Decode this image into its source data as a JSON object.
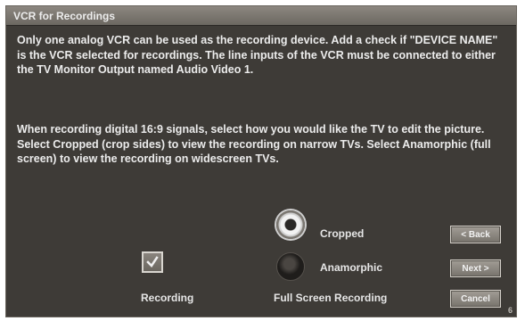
{
  "dialog": {
    "title": "VCR for Recordings",
    "paragraph1": "Only one analog VCR can be used as the recording device.  Add a check if \"DEVICE NAME\" is the VCR selected for recordings.  The line inputs of the VCR must be connected to either the TV Monitor Output named Audio Video 1.",
    "paragraph2": "When recording digital 16:9 signals, select how you would like the TV to edit the picture.  Select Cropped (crop sides) to view the recording on narrow TVs.  Select Anamorphic (full screen) to view the recording on widescreen TVs."
  },
  "options": {
    "cropped_label": "Cropped",
    "anamorphic_label": "Anamorphic",
    "selected": "Cropped",
    "group_label": "Full Screen Recording"
  },
  "recording": {
    "label": "Recording",
    "checked": true
  },
  "buttons": {
    "back": "< Back",
    "next": "Next >",
    "cancel": "Cancel"
  },
  "corner_mark": "6"
}
